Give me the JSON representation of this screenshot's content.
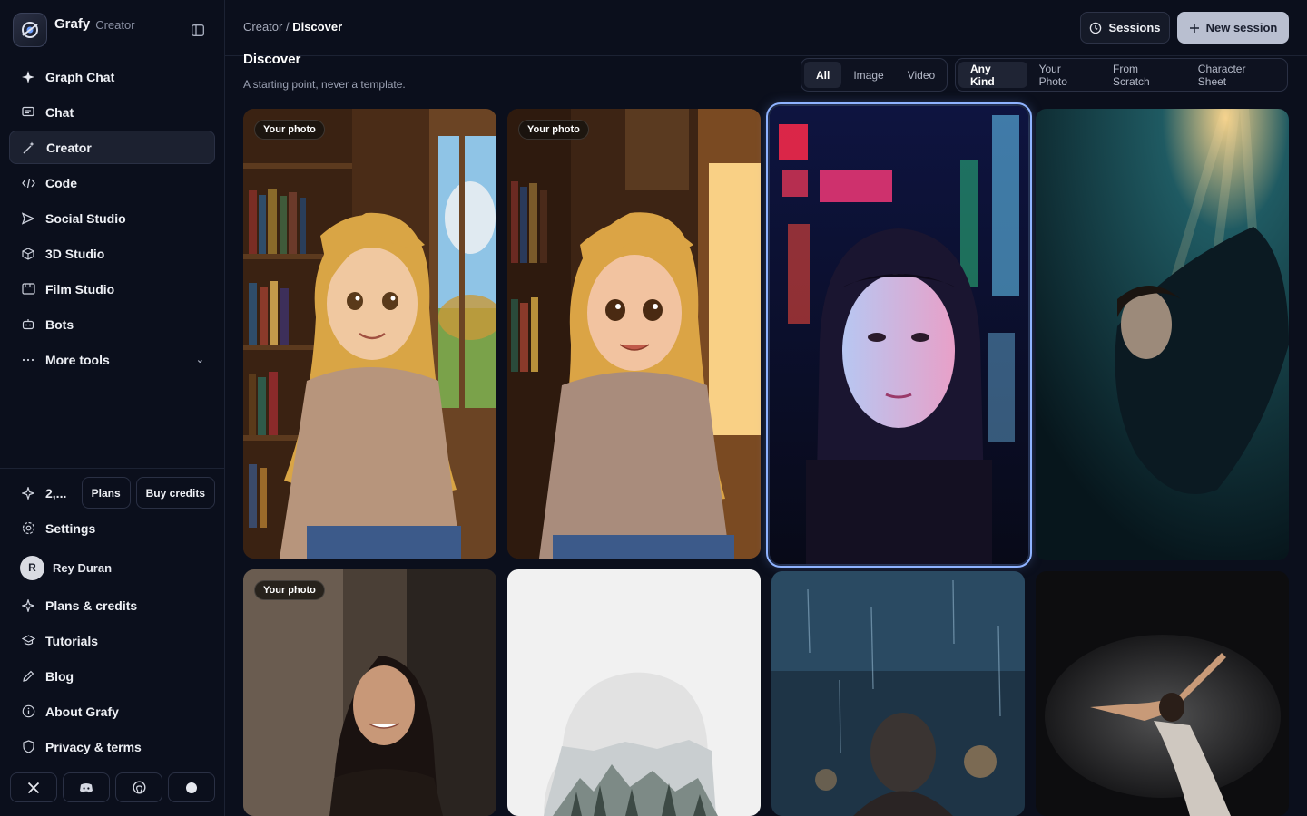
{
  "brand": {
    "name": "Grafy",
    "sub": "Creator"
  },
  "nav": [
    {
      "label": "Graph Chat",
      "icon": "sparkle-icon"
    },
    {
      "label": "Chat",
      "icon": "chat-icon"
    },
    {
      "label": "Creator",
      "icon": "magic-wand-icon",
      "active": true
    },
    {
      "label": "Code",
      "icon": "code-icon"
    },
    {
      "label": "Social Studio",
      "icon": "send-icon"
    },
    {
      "label": "3D Studio",
      "icon": "cube-icon"
    },
    {
      "label": "Film Studio",
      "icon": "film-icon"
    },
    {
      "label": "Bots",
      "icon": "bot-icon"
    },
    {
      "label": "More tools",
      "icon": "more-icon"
    }
  ],
  "credits": {
    "value": "2,...",
    "plans_label": "Plans",
    "buy_label": "Buy credits"
  },
  "bottom_nav": {
    "settings": "Settings",
    "user": {
      "initial": "R",
      "name": "Rey Duran"
    },
    "plans": "Plans & credits",
    "tutorials": "Tutorials",
    "blog": "Blog",
    "about": "About Grafy",
    "privacy": "Privacy & terms"
  },
  "socials": [
    "x-icon",
    "discord-icon",
    "github-icon",
    "circle-icon"
  ],
  "breadcrumb": {
    "parent": "Creator",
    "separator": " / ",
    "current": "Discover"
  },
  "header": {
    "sessions_label": "Sessions",
    "new_session_label": "New session"
  },
  "page": {
    "title": "Discover",
    "subtitle": "A starting point, never a template."
  },
  "media_filter": {
    "options": [
      "All",
      "Image",
      "Video"
    ],
    "selected": "All"
  },
  "kind_filter": {
    "options": [
      "Any Kind",
      "Your Photo",
      "From Scratch",
      "Character Sheet"
    ],
    "selected": "Any Kind"
  },
  "cards": [
    {
      "badge": "Your photo",
      "subject": "illustrated-girl-library"
    },
    {
      "badge": "Your photo",
      "subject": "illustrated-girl-window"
    },
    {
      "badge": "",
      "subject": "neon-hoodie-portrait",
      "selected": true
    },
    {
      "badge": "",
      "subject": "underwater-woman"
    },
    {
      "badge": "Your photo",
      "subject": "woman-brick-wall"
    },
    {
      "badge": "",
      "subject": "double-exposure-silhouette"
    },
    {
      "badge": "",
      "subject": "rain-window-woman"
    },
    {
      "badge": "",
      "subject": "dancer-smoke"
    }
  ]
}
